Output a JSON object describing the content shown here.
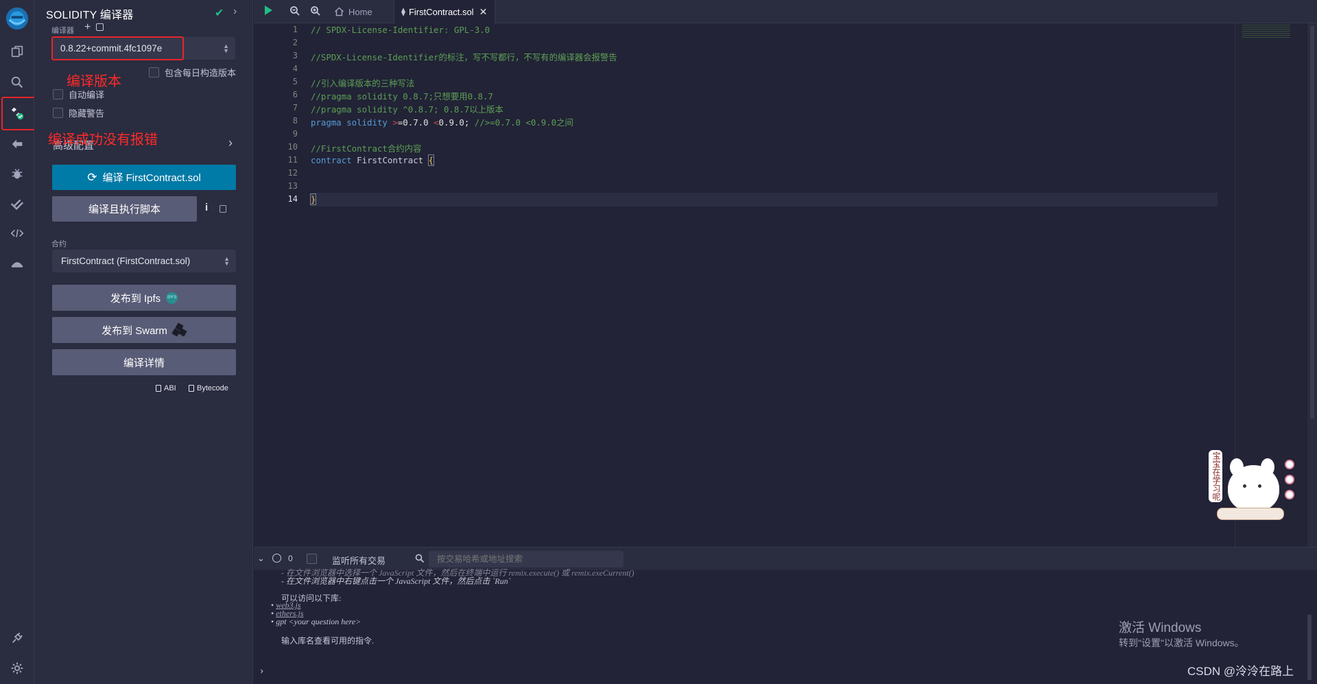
{
  "rail": {
    "items": [
      {
        "name": "remix-logo-icon",
        "clickable": true
      },
      {
        "name": "file-explorer-icon",
        "clickable": true
      },
      {
        "name": "search-icon",
        "clickable": true
      },
      {
        "name": "solidity-compiler-icon",
        "clickable": true
      },
      {
        "name": "deploy-run-icon",
        "clickable": true
      },
      {
        "name": "debugger-icon",
        "clickable": true
      },
      {
        "name": "unit-test-icon",
        "clickable": true
      },
      {
        "name": "code-icon",
        "clickable": true
      },
      {
        "name": "plugin-icon",
        "clickable": true
      },
      {
        "name": "plugin-manager-icon",
        "clickable": true
      },
      {
        "name": "settings-icon",
        "clickable": true
      }
    ]
  },
  "panel": {
    "title": "SOLIDITY 编译器",
    "compiler_label": "编译器",
    "compiler_version": "0.8.22+commit.4fc1097e",
    "include_nightly": "包含每日构造版本",
    "auto_compile": "自动编译",
    "hide_warnings": "隐藏警告",
    "advanced_config": "高级配置",
    "compile_button": "编译 FirstContract.sol",
    "compile_run_button": "编译且执行脚本",
    "contract_label": "合约",
    "contract_selected": "FirstContract (FirstContract.sol)",
    "publish_ipfs": "发布到 Ipfs",
    "ipfs_badge": "IPFS",
    "publish_swarm": "发布到 Swarm",
    "compile_details": "编译详情",
    "abi_label": "ABI",
    "bytecode_label": "Bytecode"
  },
  "annotations": {
    "version_note": "编译版本",
    "success_note": "编译成功没有报错"
  },
  "tabs": {
    "home": "Home",
    "file": "FirstContract.sol"
  },
  "editor": {
    "line_numbers": [
      "1",
      "2",
      "3",
      "4",
      "5",
      "6",
      "7",
      "8",
      "9",
      "10",
      "11",
      "12",
      "13",
      "14"
    ],
    "lines": {
      "l1": "// SPDX-License-Identifier: GPL-3.0",
      "l3": "//SPDX-License-Identifier的标注，写不写都行，不写有的编译器会报警告",
      "l5": "//引入编译版本的三种写法",
      "l6": "//pragma solidity 0.8.7;只想要用0.8.7",
      "l7": "//pragma solidity ^0.8.7; 0.8.7以上版本",
      "l8_kw": "pragma solidity",
      "l8_op1": ">",
      "l8_v1": "=0.7.0",
      "l8_op2": "<",
      "l8_v2": "0.9.0;",
      "l8_comment": "//>=0.7.0 <0.9.0之间",
      "l10": "//FirstContract合约内容",
      "l11_kw": "contract",
      "l11_name": "FirstContract",
      "l11_brace": "{",
      "l14": "}"
    }
  },
  "terminal": {
    "count": "0",
    "listen_all": "监听所有交易",
    "search_placeholder": "按交易哈希或地址搜索",
    "cut_line": "- 在文件浏览器中选择一个 JavaScript 文件，然后在终端中运行 remix.execute() 或 remix.exeCurrent()",
    "run_hint": "- 在文件浏览器中右键点击一个 JavaScript 文件，然后点击 `Run`",
    "libs_intro": "可以访问以下库:",
    "lib1": "web3.js",
    "lib2": "ethers.js",
    "lib3": "gpt <your question here>",
    "command_hint": "输入库名查看可用的指令.",
    "prompt": "›"
  },
  "watermark": {
    "activate_title": "激活 Windows",
    "activate_sub": "转到\"设置\"以激活 Windows。",
    "csdn": "CSDN @泠泠在路上",
    "sticker_text": "宝宝在学习呢"
  },
  "colors": {
    "accent": "#007aa6",
    "annotation_red": "#e8242a",
    "success_green": "#1fbd84"
  }
}
